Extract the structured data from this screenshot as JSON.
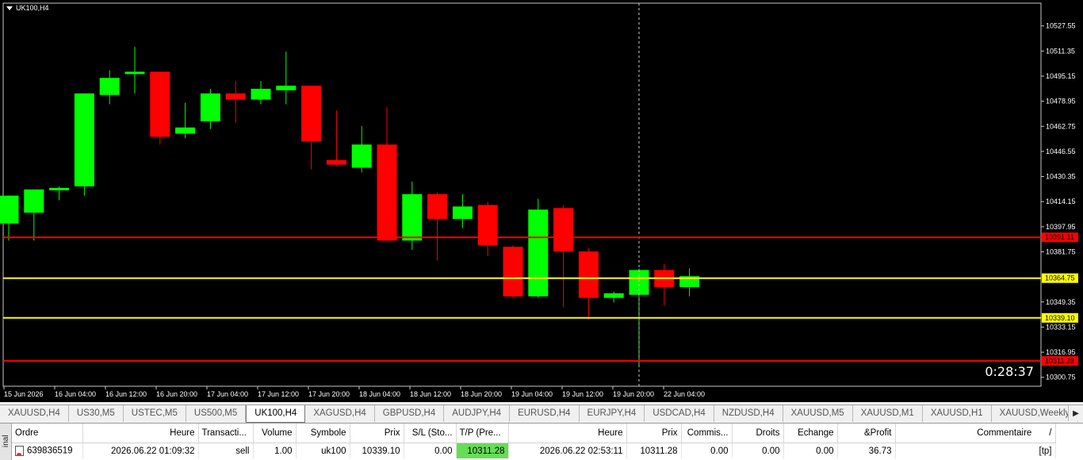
{
  "chart": {
    "symbol": "UK100,H4",
    "countdown": "0:28:37",
    "price_labels": [
      "10527.55",
      "10511.35",
      "10495.15",
      "10478.95",
      "10462.75",
      "10446.55",
      "10430.35",
      "10414.15",
      "10397.95",
      "10381.75",
      "10349.35",
      "10333.15",
      "10316.95",
      "10300.75"
    ],
    "time_labels": [
      "15 Jun 2026",
      "16 Jun 04:00",
      "16 Jun 12:00",
      "16 Jun 20:00",
      "17 Jun 04:00",
      "17 Jun 12:00",
      "17 Jun 20:00",
      "18 Jun 04:00",
      "18 Jun 12:00",
      "18 Jun 20:00",
      "19 Jun 04:00",
      "19 Jun 12:00",
      "19 Jun 20:00",
      "22 Jun 04:00"
    ],
    "colors": {
      "background": "#000000",
      "bull": "#00ff00",
      "bear": "#ff0000",
      "sl_tp_line": "#ff0000",
      "order_line": "#ffff00",
      "axis_text": "#ffffff"
    }
  },
  "chart_data": {
    "type": "candlestick",
    "title": "UK100,H4",
    "ylim": [
      10296,
      10532
    ],
    "candles": [
      {
        "o": 10400,
        "h": 10412,
        "l": 10389,
        "c": 10418
      },
      {
        "o": 10407,
        "h": 10422,
        "l": 10389,
        "c": 10422
      },
      {
        "o": 10422,
        "h": 10424,
        "l": 10415,
        "c": 10423
      },
      {
        "o": 10424,
        "h": 10483,
        "l": 10418,
        "c": 10484
      },
      {
        "o": 10483,
        "h": 10499,
        "l": 10477,
        "c": 10494
      },
      {
        "o": 10497,
        "h": 10514,
        "l": 10484,
        "c": 10498
      },
      {
        "o": 10498,
        "h": 10498,
        "l": 10451,
        "c": 10456
      },
      {
        "o": 10458,
        "h": 10478,
        "l": 10455,
        "c": 10462
      },
      {
        "o": 10466,
        "h": 10487,
        "l": 10461,
        "c": 10484
      },
      {
        "o": 10484,
        "h": 10492,
        "l": 10465,
        "c": 10480
      },
      {
        "o": 10480,
        "h": 10492,
        "l": 10477,
        "c": 10487
      },
      {
        "o": 10486,
        "h": 10511,
        "l": 10477,
        "c": 10489
      },
      {
        "o": 10489,
        "h": 10489,
        "l": 10435,
        "c": 10453
      },
      {
        "o": 10441,
        "h": 10473,
        "l": 10437,
        "c": 10438
      },
      {
        "o": 10436,
        "h": 10463,
        "l": 10433,
        "c": 10451
      },
      {
        "o": 10451,
        "h": 10475,
        "l": 10390,
        "c": 10389
      },
      {
        "o": 10389,
        "h": 10427,
        "l": 10383,
        "c": 10419
      },
      {
        "o": 10419,
        "h": 10420,
        "l": 10376,
        "c": 10403
      },
      {
        "o": 10403,
        "h": 10419,
        "l": 10397,
        "c": 10411
      },
      {
        "o": 10412,
        "h": 10414,
        "l": 10379,
        "c": 10386
      },
      {
        "o": 10385,
        "h": 10386,
        "l": 10352,
        "c": 10353
      },
      {
        "o": 10353,
        "h": 10416,
        "l": 10352,
        "c": 10409
      },
      {
        "o": 10410,
        "h": 10412,
        "l": 10346,
        "c": 10382
      },
      {
        "o": 10382,
        "h": 10384,
        "l": 10338,
        "c": 10352
      },
      {
        "o": 10352,
        "h": 10356,
        "l": 10349,
        "c": 10355
      },
      {
        "o": 10354,
        "h": 10371,
        "l": 10308,
        "c": 10370
      },
      {
        "o": 10370,
        "h": 10374,
        "l": 10347,
        "c": 10359
      },
      {
        "o": 10359,
        "h": 10371,
        "l": 10353,
        "c": 10366
      }
    ],
    "horizontal_lines": [
      {
        "price": 10391.11,
        "color": "#ff0000",
        "label": "10391.11"
      },
      {
        "price": 10364.75,
        "color": "#ffff00",
        "label": "10364.75"
      },
      {
        "price": 10339.1,
        "color": "#ffff00",
        "label": "10339.10"
      },
      {
        "price": 10311.28,
        "color": "#ff0000",
        "label": "10311.28"
      }
    ],
    "crosshair_candle_index": 25
  },
  "tabs": [
    "XAUUSD,H4",
    "US30,M5",
    "USTEC,M5",
    "US500,M5",
    "UK100,H4",
    "XAGUSD,H4",
    "GBPUSD,H4",
    "AUDJPY,H4",
    "EURUSD,H4",
    "EURJPY,H4",
    "USDCAD,H4",
    "NZDUSD,H4",
    "XAUUSD,M5",
    "XAUUSD,M1",
    "XAUUSD,H1",
    "XAUUSD,Weekly"
  ],
  "active_tab": "UK100,H4",
  "terminal": {
    "side_label": "inal",
    "columns": [
      "Ordre",
      "Heure",
      "Transacti...",
      "Volume",
      "Symbole",
      "Prix",
      "S/L (Sto...",
      "T/P (Pre...",
      "Heure",
      "Prix",
      "Commis...",
      "Droits",
      "Echange",
      "&Profit",
      "Commentaire"
    ],
    "sort_marker": "/",
    "rows": [
      {
        "ordre": "639836519",
        "heure": "2026.06.22 01:09:32",
        "type": "sell",
        "volume": "1.00",
        "symbole": "uk100",
        "prix": "10339.10",
        "sl": "0.00",
        "tp": "10311.28",
        "heure2": "2026.06.22 02:53:11",
        "prix2": "10311.28",
        "commission": "0.00",
        "droits": "0.00",
        "echange": "0.00",
        "profit": "36.73",
        "commentaire": "[tp]"
      }
    ]
  }
}
